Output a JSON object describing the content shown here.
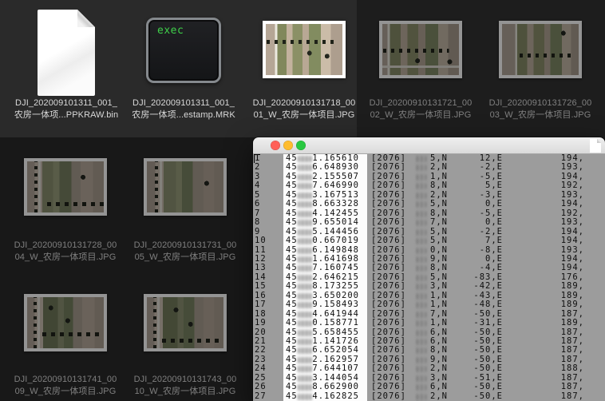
{
  "desktop": {
    "files": [
      {
        "type": "document",
        "label_line1": "DJI_202009101311_001_",
        "label_line2": "农房一体项...PPKRAW.bin",
        "dim": false
      },
      {
        "type": "executable",
        "badge": "exec",
        "label_line1": "DJI_202009101311_001_",
        "label_line2": "农房一体项...estamp.MRK",
        "dim": false
      },
      {
        "type": "image",
        "variant": 1,
        "label_line1": "DJI_20200910131718_00",
        "label_line2": "01_W_农房一体项目.JPG",
        "dim": false
      },
      {
        "type": "image",
        "variant": 2,
        "label_line1": "DJI_20200910131721_00",
        "label_line2": "02_W_农房一体项目.JPG",
        "dim": true
      },
      {
        "type": "image",
        "variant": 3,
        "label_line1": "DJI_20200910131726_00",
        "label_line2": "03_W_农房一体项目.JPG",
        "dim": true
      },
      {
        "type": "image",
        "variant": 4,
        "label_line1": "DJI_20200910131728_00",
        "label_line2": "04_W_农房一体项目.JPG",
        "dim": true
      },
      {
        "type": "image",
        "variant": 5,
        "label_line1": "DJI_20200910131731_00",
        "label_line2": "05_W_农房一体项目.JPG",
        "dim": true
      },
      {
        "type": "image",
        "variant": 6,
        "label_line1": "DJI_20200910131741_00",
        "label_line2": "09_W_农房一体项目.JPG",
        "dim": true
      },
      {
        "type": "image",
        "variant": 7,
        "label_line1": "DJI_20200910131743_00",
        "label_line2": "10_W_农房一体项目.JPG",
        "dim": true
      }
    ]
  },
  "viewer": {
    "controls": [
      "close",
      "minimize",
      "zoom"
    ],
    "time_prefix": "45",
    "week": "[2076]",
    "rows": [
      {
        "num": "1",
        "t": "1.165610",
        "n": "5,N",
        "e": "12,E",
        "a": "194,"
      },
      {
        "num": "2",
        "t": "6.648930",
        "n": "2,N",
        "e": "-2,E",
        "a": "193,"
      },
      {
        "num": "3",
        "t": "2.155507",
        "n": "1,N",
        "e": "-5,E",
        "a": "194,"
      },
      {
        "num": "4",
        "t": "7.646990",
        "n": "8,N",
        "e": "5,E",
        "a": "192,"
      },
      {
        "num": "5",
        "t": "3.167513",
        "n": "2,N",
        "e": "-3,E",
        "a": "193,"
      },
      {
        "num": "6",
        "t": "8.663328",
        "n": "5,N",
        "e": "0,E",
        "a": "194,"
      },
      {
        "num": "7",
        "t": "4.142455",
        "n": "8,N",
        "e": "-5,E",
        "a": "192,"
      },
      {
        "num": "8",
        "t": "9.655014",
        "n": "7,N",
        "e": "0,E",
        "a": "193,"
      },
      {
        "num": "9",
        "t": "5.144456",
        "n": "5,N",
        "e": "-2,E",
        "a": "194,"
      },
      {
        "num": "10",
        "t": "0.667019",
        "n": "5,N",
        "e": "7,E",
        "a": "194,"
      },
      {
        "num": "11",
        "t": "6.149848",
        "n": "0,N",
        "e": "-8,E",
        "a": "193,"
      },
      {
        "num": "12",
        "t": "1.641698",
        "n": "9,N",
        "e": "0,E",
        "a": "194,"
      },
      {
        "num": "13",
        "t": "7.160745",
        "n": "8,N",
        "e": "-4,E",
        "a": "194,"
      },
      {
        "num": "14",
        "t": "2.646215",
        "n": "5,N",
        "e": "-83,E",
        "a": "176,"
      },
      {
        "num": "15",
        "t": "8.173255",
        "n": "3,N",
        "e": "-42,E",
        "a": "189,"
      },
      {
        "num": "16",
        "t": "3.650200",
        "n": "1,N",
        "e": "-43,E",
        "a": "189,"
      },
      {
        "num": "17",
        "t": "9.158493",
        "n": "1,N",
        "e": "-48,E",
        "a": "189,"
      },
      {
        "num": "18",
        "t": "4.641944",
        "n": "7,N",
        "e": "-50,E",
        "a": "187,"
      },
      {
        "num": "19",
        "t": "0.158771",
        "n": "1,N",
        "e": "-31,E",
        "a": "189,"
      },
      {
        "num": "20",
        "t": "5.658455",
        "n": "6,N",
        "e": "-50,E",
        "a": "187,"
      },
      {
        "num": "21",
        "t": "1.141726",
        "n": "6,N",
        "e": "-50,E",
        "a": "187,"
      },
      {
        "num": "22",
        "t": "6.652054",
        "n": "8,N",
        "e": "-50,E",
        "a": "187,"
      },
      {
        "num": "23",
        "t": "2.162957",
        "n": "9,N",
        "e": "-50,E",
        "a": "187,"
      },
      {
        "num": "24",
        "t": "7.644107",
        "n": "2,N",
        "e": "-50,E",
        "a": "188,"
      },
      {
        "num": "25",
        "t": "3.144054",
        "n": "3,N",
        "e": "-51,E",
        "a": "187,"
      },
      {
        "num": "26",
        "t": "8.662900",
        "n": "6,N",
        "e": "-50,E",
        "a": "187,"
      },
      {
        "num": "27",
        "t": "4.162825",
        "n": "2,N",
        "e": "-50,E",
        "a": "187,"
      }
    ]
  },
  "colors": {
    "close_button": "#ff5f57",
    "minimize_button": "#febc2e",
    "zoom_button": "#28c840",
    "exec_text": "#3fd04a",
    "viewer_background": "#9c9c9c",
    "highlight_column": "#fcfcfc"
  }
}
